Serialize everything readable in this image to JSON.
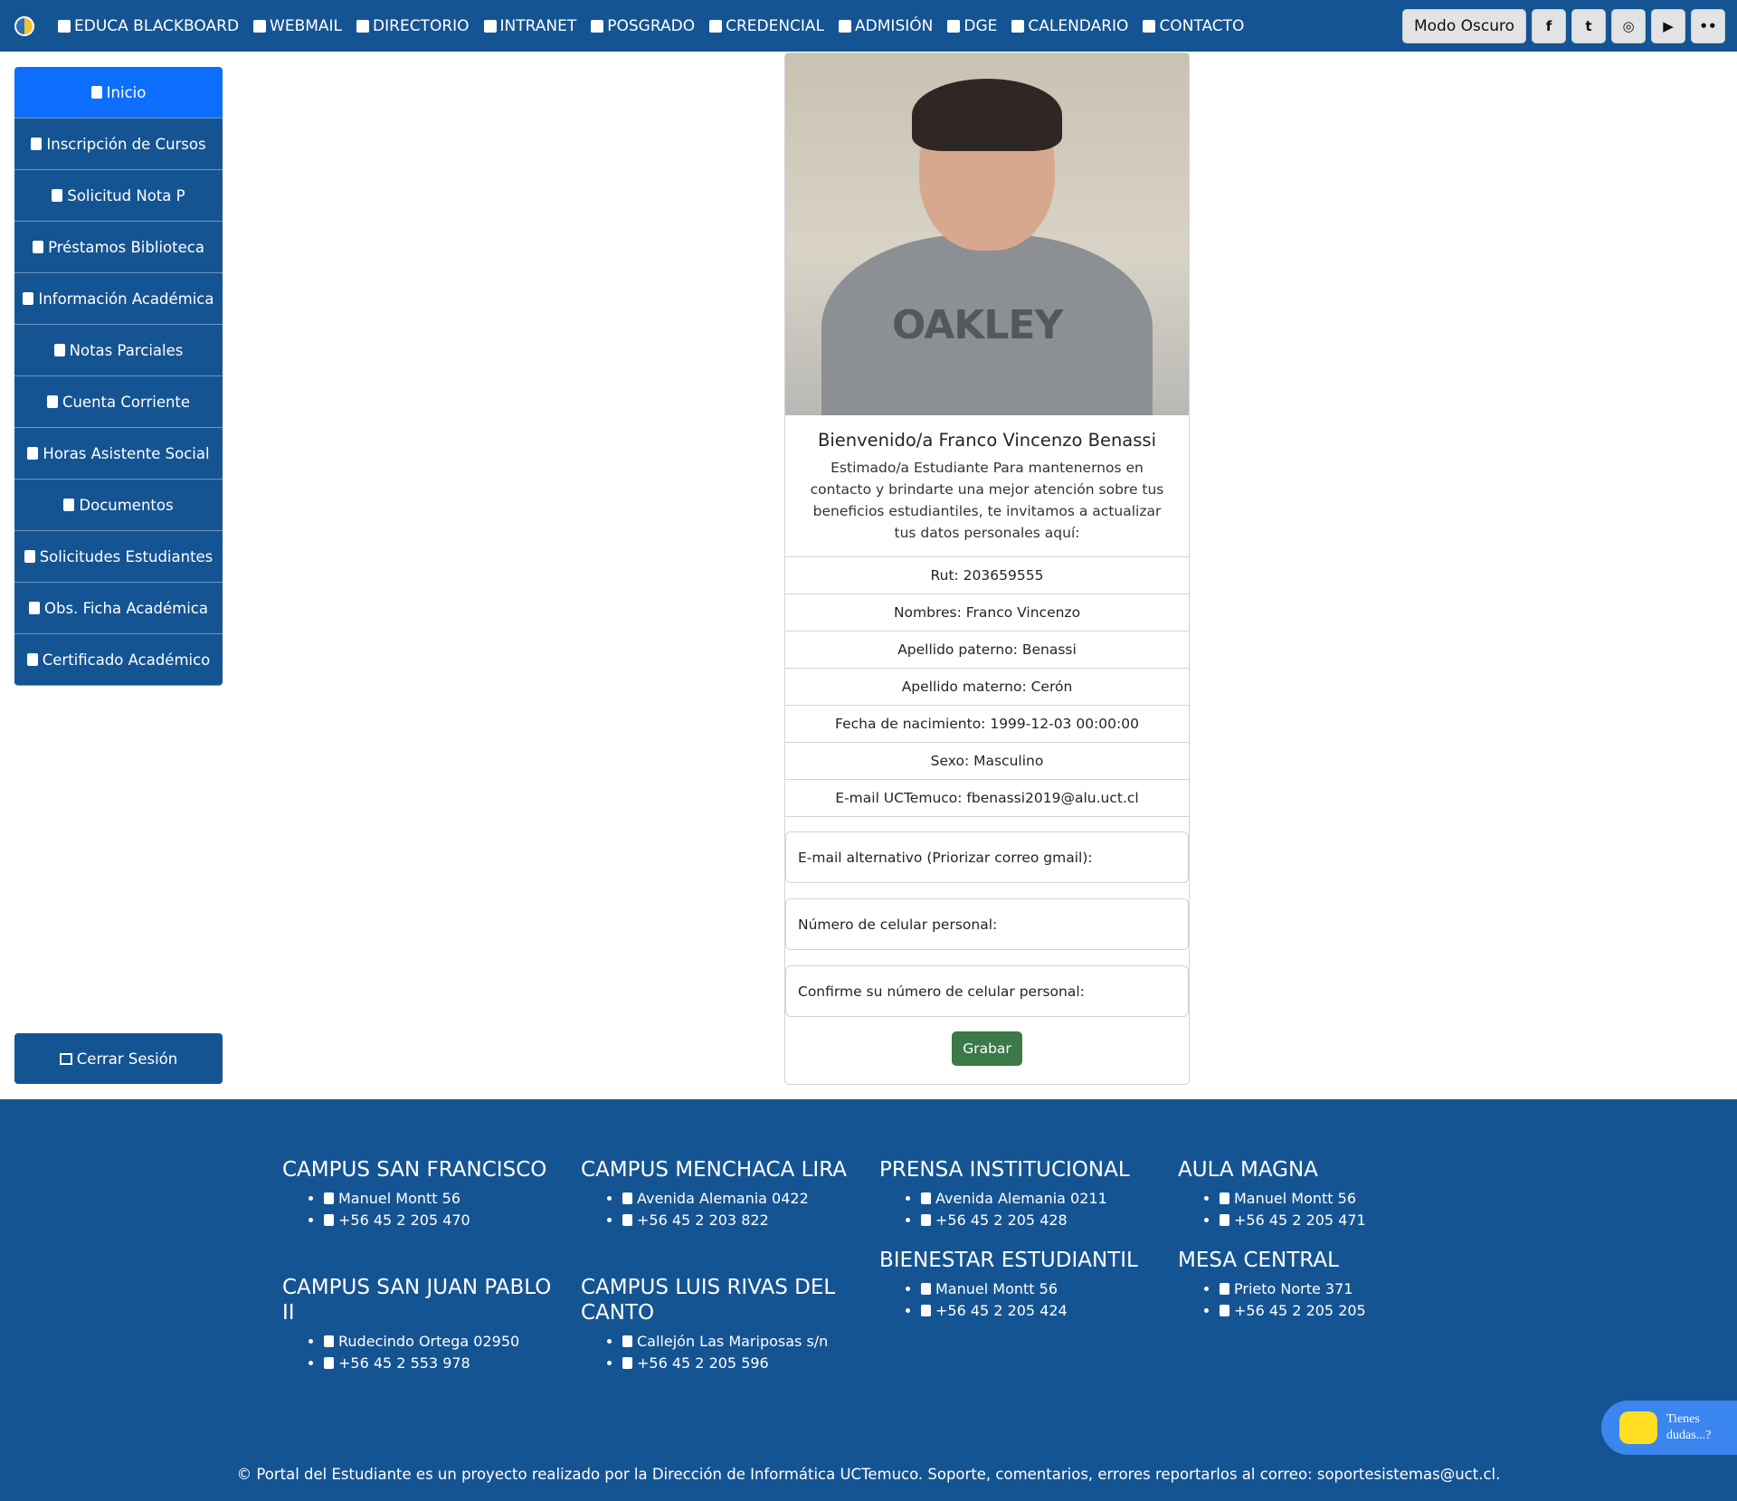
{
  "navbar": {
    "links": [
      {
        "label": "EDUCA BLACKBOARD",
        "icon": "edit-icon"
      },
      {
        "label": "WEBMAIL",
        "icon": "envelope-icon"
      },
      {
        "label": "DIRECTORIO",
        "icon": "users-icon"
      },
      {
        "label": "INTRANET",
        "icon": "lock-icon"
      },
      {
        "label": "POSGRADO",
        "icon": "graduation-cap-icon"
      },
      {
        "label": "CREDENCIAL",
        "icon": "id-card-icon"
      },
      {
        "label": "ADMISIÓN",
        "icon": "hand-pointer-icon"
      },
      {
        "label": "DGE",
        "icon": "university-icon"
      },
      {
        "label": "CALENDARIO",
        "icon": "calendar-icon"
      },
      {
        "label": "CONTACTO",
        "icon": "address-card-icon"
      }
    ],
    "dark_mode_label": "Modo Oscuro",
    "social": [
      {
        "name": "facebook-icon",
        "glyph": "f"
      },
      {
        "name": "twitter-icon",
        "glyph": "t"
      },
      {
        "name": "instagram-icon",
        "glyph": "◎"
      },
      {
        "name": "youtube-icon",
        "glyph": "▶"
      },
      {
        "name": "flickr-icon",
        "glyph": "••"
      }
    ]
  },
  "sidebar": {
    "items": [
      {
        "label": "Inicio",
        "icon": "id-badge-icon"
      },
      {
        "label": "Inscripción de Cursos",
        "icon": "comment-icon"
      },
      {
        "label": "Solicitud Nota P",
        "icon": "signature-icon"
      },
      {
        "label": "Préstamos Biblioteca",
        "icon": "book-icon"
      },
      {
        "label": "Información Académica",
        "icon": "file-alt-icon"
      },
      {
        "label": "Notas Parciales",
        "icon": "list-alt-icon"
      },
      {
        "label": "Cuenta Corriente",
        "icon": "credit-card-icon"
      },
      {
        "label": "Horas Asistente Social",
        "icon": "clock-icon"
      },
      {
        "label": "Documentos",
        "icon": "file-icon"
      },
      {
        "label": "Solicitudes Estudiantes",
        "icon": "signature-icon"
      },
      {
        "label": "Obs. Ficha Académica",
        "icon": "clipboard-icon"
      },
      {
        "label": "Certificado Académico",
        "icon": "stamp-icon"
      }
    ],
    "logout_label": "Cerrar Sesión"
  },
  "profile": {
    "photo_logo": "OAKLEY",
    "welcome": "Bienvenido/a Franco Vincenzo Benassi",
    "message": "Estimado/a Estudiante Para mantenernos en contacto y brindarte una mejor atención sobre tus beneficios estudiantiles, te invitamos a actualizar tus datos personales aquí:",
    "rows": [
      "Rut: 203659555",
      "Nombres: Franco Vincenzo",
      "Apellido paterno: Benassi",
      "Apellido materno: Cerón",
      "Fecha de nacimiento: 1999-12-03 00:00:00",
      "Sexo: Masculino",
      "E-mail UCTemuco: fbenassi2019@alu.uct.cl"
    ],
    "fields": [
      "E-mail alternativo (Priorizar correo gmail):",
      "Número de celular personal:",
      "Confirme su número de celular personal:"
    ],
    "save_label": "Grabar"
  },
  "footer": {
    "sections": [
      {
        "title": "CAMPUS SAN FRANCISCO",
        "address": "Manuel Montt 56",
        "phone": "+56 45 2 205 470"
      },
      {
        "title": "CAMPUS MENCHACA LIRA",
        "address": "Avenida Alemania 0422",
        "phone": "+56 45 2 203 822"
      },
      {
        "title": "PRENSA INSTITUCIONAL",
        "address": "Avenida Alemania 0211",
        "phone": "+56 45 2 205 428"
      },
      {
        "title": "AULA MAGNA",
        "address": "Manuel Montt 56",
        "phone": "+56 45 2 205 471"
      },
      {
        "title": "CAMPUS SAN JUAN PABLO II",
        "address": "Rudecindo Ortega 02950",
        "phone": "+56 45 2 553 978"
      },
      {
        "title": "CAMPUS LUIS RIVAS DEL CANTO",
        "address": "Callejón Las Mariposas s/n",
        "phone": "+56 45 2 205 596"
      },
      {
        "title": "BIENESTAR ESTUDIANTIL",
        "address": "Manuel Montt 56",
        "phone": "+56 45 2 205 424"
      },
      {
        "title": "MESA CENTRAL",
        "address": "Prieto Norte 371",
        "phone": "+56 45 2 205 205"
      }
    ],
    "copyright": "© Portal del Estudiante es un proyecto realizado por la Dirección de Informática UCTemuco. Soporte, comentarios, errores reportarlos al correo: soportesistemas@uct.cl."
  },
  "chat": {
    "label_line1": "Tienes",
    "label_line2": "dudas...?"
  },
  "colors": {
    "primary": "#155493",
    "active": "#0d6efd",
    "save": "#3b7a48",
    "chat": "#3c86f0"
  }
}
